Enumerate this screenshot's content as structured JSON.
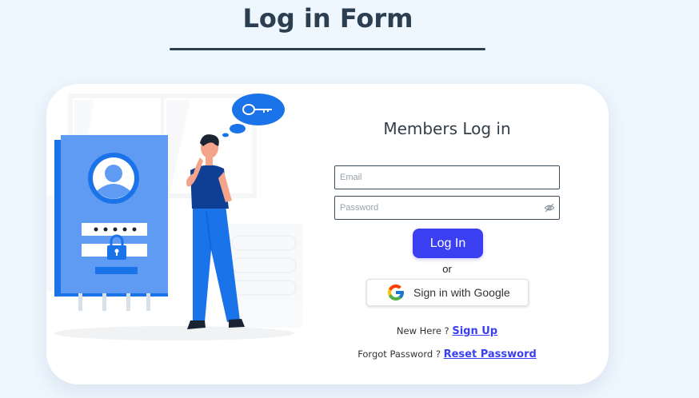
{
  "header": {
    "title": "Log in Form"
  },
  "form": {
    "heading": "Members Log in",
    "email_placeholder": "Email",
    "password_placeholder": "Password",
    "login_label": "Log In",
    "or_label": "or",
    "google_label": "Sign in with Google",
    "signup_prompt": "New Here ?",
    "signup_link": "Sign Up",
    "forgot_prompt": "Forgot Password ?",
    "reset_link": "Reset Password"
  },
  "colors": {
    "page_background": "#eef6fe",
    "title": "#2c3f50",
    "accent": "#3b3ff2",
    "illustration_blue": "#1a73e8"
  },
  "icons": {
    "eye": "eye-slash-icon",
    "google": "google-logo-icon",
    "key": "key-icon",
    "lock": "padlock-icon",
    "user": "user-avatar-icon"
  }
}
